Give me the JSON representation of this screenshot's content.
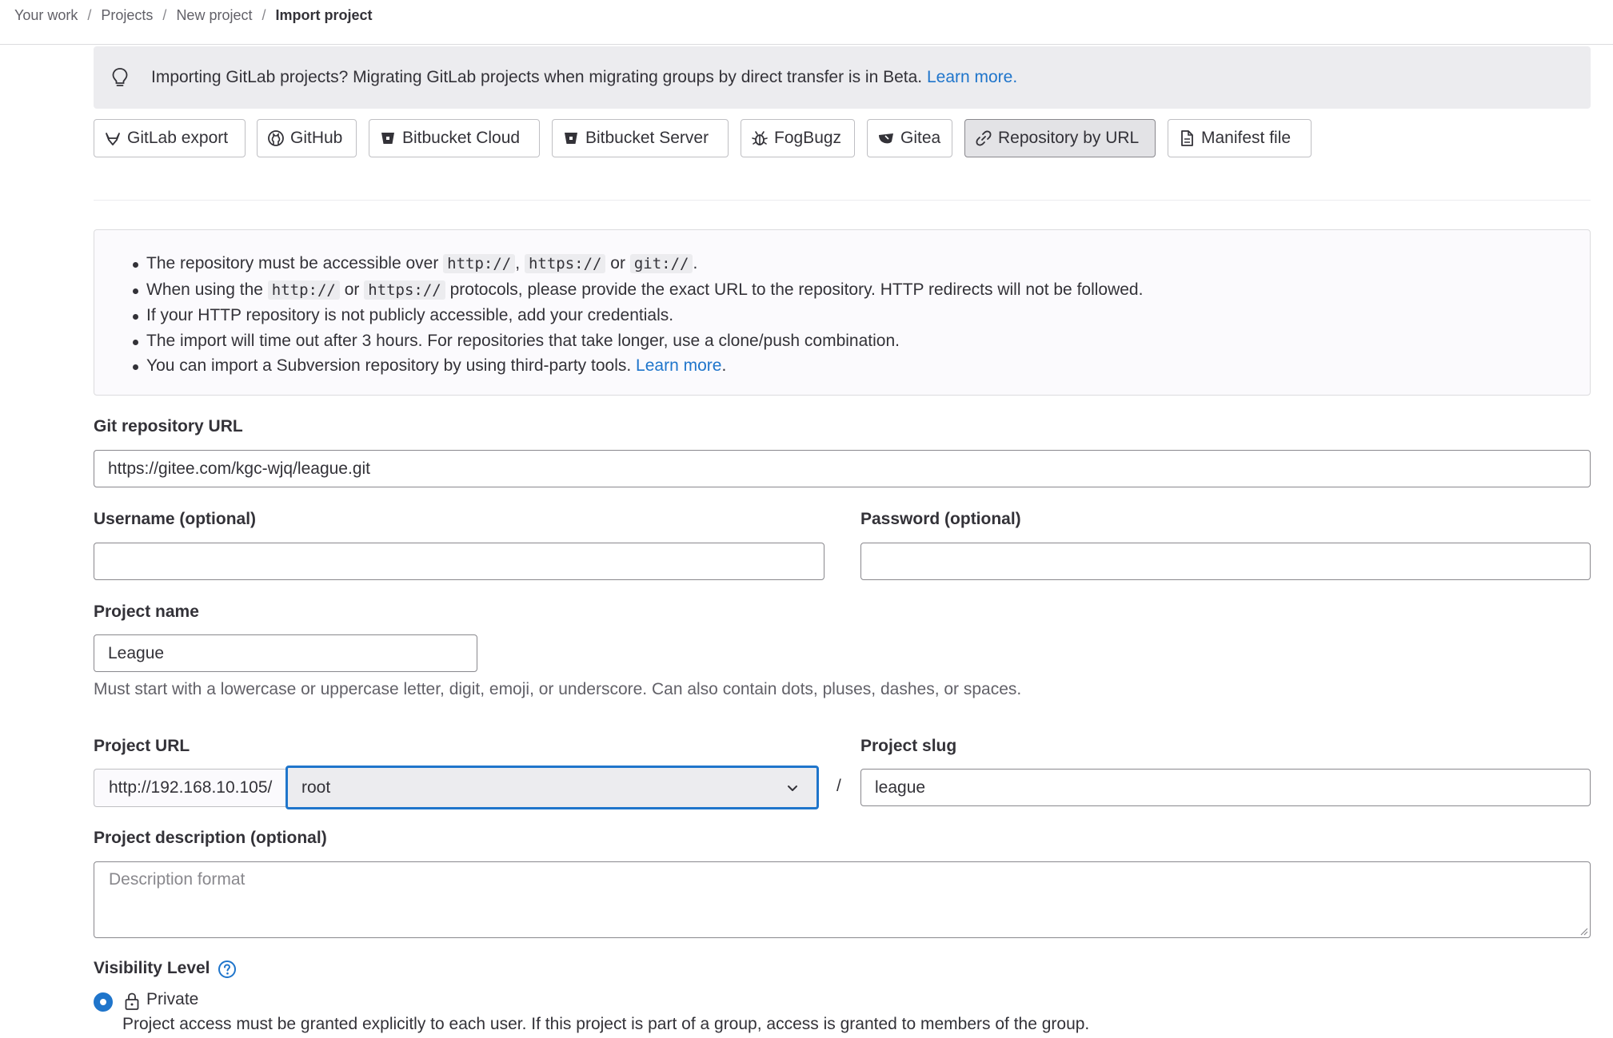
{
  "breadcrumb": {
    "items": [
      "Your work",
      "Projects",
      "New project"
    ],
    "separator": "/",
    "current": "Import project"
  },
  "alert": {
    "icon": "lightbulb-icon",
    "text": "Importing GitLab projects? Migrating GitLab projects when migrating groups by direct transfer is in Beta.",
    "link": "Learn more."
  },
  "import_tabs": [
    {
      "label": "GitLab export",
      "icon": "tanuki-icon"
    },
    {
      "label": "GitHub",
      "icon": "github-icon"
    },
    {
      "label": "Bitbucket Cloud",
      "icon": "bitbucket-icon"
    },
    {
      "label": "Bitbucket Server",
      "icon": "bitbucket-icon"
    },
    {
      "label": "FogBugz",
      "icon": "bug-icon"
    },
    {
      "label": "Gitea",
      "icon": "gitea-icon"
    },
    {
      "label": "Repository by URL",
      "icon": "link-icon",
      "active": true
    },
    {
      "label": "Manifest file",
      "icon": "document-icon"
    }
  ],
  "info": {
    "item1": {
      "pre": "The repository must be accessible over",
      "code1": "http://",
      "sep": ",",
      "code2": "https://",
      "or": "or",
      "code3": "git://",
      "post": "."
    },
    "item2": {
      "pre": "When using the",
      "code1": "http://",
      "or": "or",
      "code2": "https://",
      "post": "protocols, please provide the exact URL to the repository. HTTP redirects will not be followed."
    },
    "item3": "If your HTTP repository is not publicly accessible, add your credentials.",
    "item4": "The import will time out after 3 hours. For repositories that take longer, use a clone/push combination.",
    "item5": {
      "text": "You can import a Subversion repository by using third-party tools.",
      "link": "Learn more",
      "post": "."
    }
  },
  "form": {
    "git_url_label": "Git repository URL",
    "git_url_value": "https://gitee.com/kgc-wjq/league.git",
    "username_label": "Username (optional)",
    "username_value": "",
    "password_label": "Password (optional)",
    "password_value": "",
    "project_name_label": "Project name",
    "project_name_value": "League",
    "project_name_help": "Must start with a lowercase or uppercase letter, digit, emoji, or underscore. Can also contain dots, pluses, dashes, or spaces.",
    "project_url_label": "Project URL",
    "project_url_prefix": "http://192.168.10.105/",
    "namespace_value": "root",
    "slash": "/",
    "project_slug_label": "Project slug",
    "project_slug_value": "league",
    "description_label": "Project description (optional)",
    "description_placeholder": "Description format",
    "visibility_label": "Visibility Level",
    "visibility_option": "Private",
    "visibility_help": "Project access must be granted explicitly to each user. If this project is part of a group, access is granted to members of the group."
  },
  "colors": {
    "link": "#1f75cb",
    "focus": "#1f75cb",
    "text": "#333238",
    "muted": "#626168"
  }
}
